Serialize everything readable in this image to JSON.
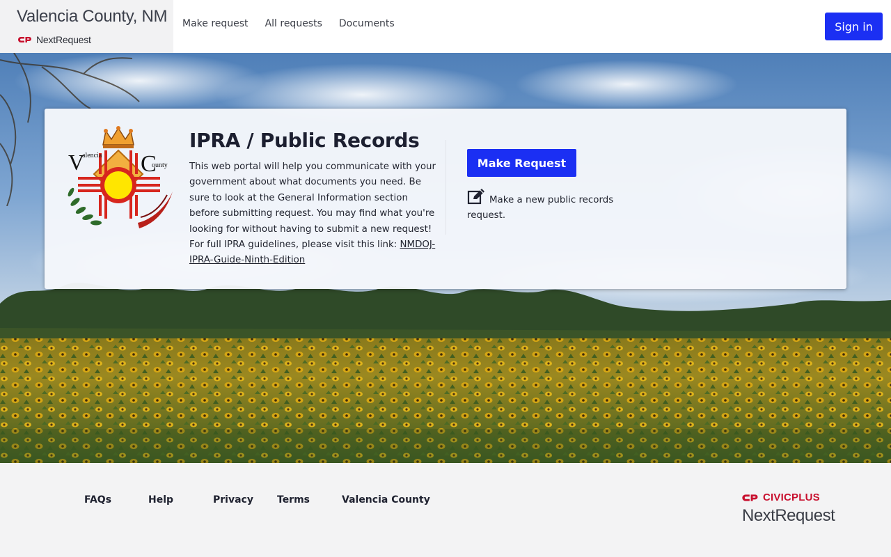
{
  "header": {
    "county_name": "Valencia County, NM",
    "brand": "NextRequest",
    "nav": [
      {
        "label": "Make request"
      },
      {
        "label": "All requests"
      },
      {
        "label": "Documents"
      }
    ],
    "sign_in_label": "Sign in"
  },
  "card": {
    "title": "IPRA / Public Records",
    "description": "This web portal will help you communicate with your government about what documents you need. Be sure to look at the General Information section before submitting request. You may find what you're looking for without having to submit a new request! For full IPRA guidelines, please visit this link: ",
    "link_text": "NMDOJ-IPRA-Guide-Ninth-Edition",
    "make_request_label": "Make Request",
    "make_request_hint": "Make a new public records request.",
    "seal_letters": [
      "V",
      "alencia",
      "C",
      "ounty"
    ]
  },
  "footer": {
    "links": [
      {
        "label": "FAQs"
      },
      {
        "label": "Help"
      },
      {
        "label": "Privacy"
      },
      {
        "label": "Terms"
      },
      {
        "label": "Valencia County"
      }
    ],
    "civicplus": "CIVICPLUS",
    "nextrequest": "NextRequest"
  },
  "colors": {
    "primary": "#1b2ff3",
    "civic_red": "#c8102e",
    "zia_red": "#d7261e",
    "zia_yellow": "#ffe600"
  },
  "icons": [
    "cp-logo-icon",
    "edit-icon",
    "crown-icon",
    "zia-sun-icon"
  ]
}
